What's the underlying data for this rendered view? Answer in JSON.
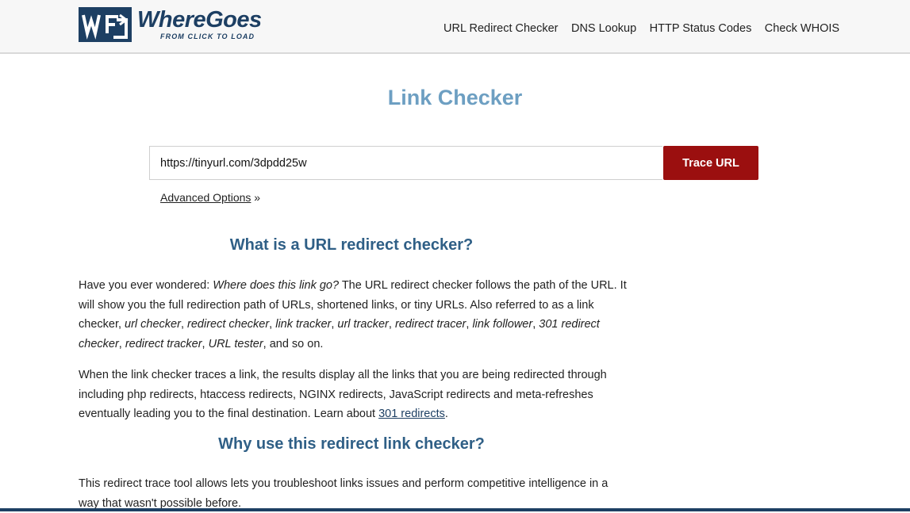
{
  "header": {
    "logo_word": "WhereGoes",
    "logo_tagline": "FROM CLICK TO LOAD",
    "nav": [
      "URL Redirect Checker",
      "DNS Lookup",
      "HTTP Status Codes",
      "Check WHOIS"
    ]
  },
  "main": {
    "title": "Link Checker",
    "url_value": "https://tinyurl.com/3dpdd25w",
    "trace_button": "Trace URL",
    "advanced_options": "Advanced Options",
    "advanced_suffix": " »"
  },
  "section1": {
    "heading": "What is a URL redirect checker?",
    "p1": [
      {
        "t": "Have you ever wondered: "
      },
      {
        "t": "Where does this link go?",
        "i": true
      },
      {
        "t": " The URL redirect checker follows the path of the URL. It will show you the full redirection path of URLs, shortened links, or tiny URLs. Also referred to as a link checker, "
      },
      {
        "t": "url checker",
        "i": true
      },
      {
        "t": ", "
      },
      {
        "t": "redirect checker",
        "i": true
      },
      {
        "t": ", "
      },
      {
        "t": "link tracker",
        "i": true
      },
      {
        "t": ", "
      },
      {
        "t": "url tracker",
        "i": true
      },
      {
        "t": ", "
      },
      {
        "t": "redirect tracer",
        "i": true
      },
      {
        "t": ", "
      },
      {
        "t": "link follower",
        "i": true
      },
      {
        "t": ", "
      },
      {
        "t": "301 redirect checker",
        "i": true
      },
      {
        "t": ", "
      },
      {
        "t": "redirect tracker",
        "i": true
      },
      {
        "t": ", "
      },
      {
        "t": "URL tester",
        "i": true
      },
      {
        "t": ", and so on."
      }
    ],
    "p2": [
      {
        "t": "When the link checker traces a link, the results display all the links that you are being redirected through including php redirects, htaccess redirects, NGINX redirects, JavaScript redirects and meta-refreshes eventually leading you to the final destination. Learn about "
      },
      {
        "t": "301 redirects",
        "link": true
      },
      {
        "t": "."
      }
    ]
  },
  "section2": {
    "heading": "Why use this redirect link checker?",
    "p1": [
      {
        "t": "This redirect trace tool allows lets you troubleshoot links issues and perform competitive intelligence in a way that wasn't possible before."
      }
    ]
  },
  "colors": {
    "brand": "#1d3f63",
    "title": "#6d9fc2",
    "heading": "#2f5f86",
    "button": "#9b0f0f"
  }
}
